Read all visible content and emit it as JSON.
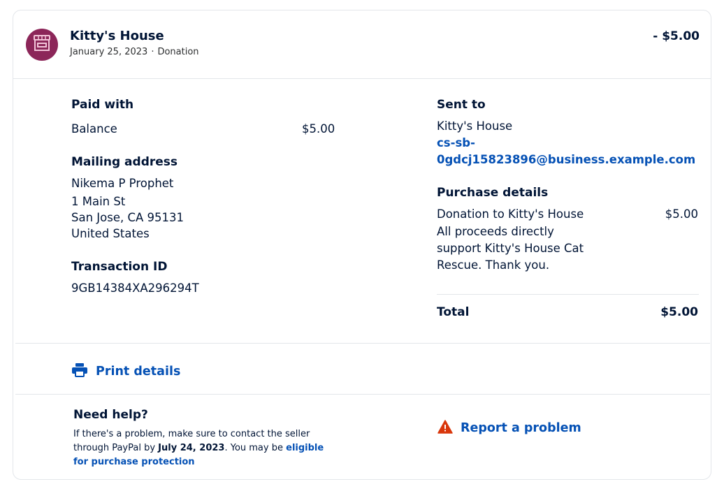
{
  "header": {
    "merchant_name": "Kitty's House",
    "date": "January 25, 2023",
    "separator": "·",
    "type": "Donation",
    "amount": "- $5.00",
    "avatar_icon": "store-icon",
    "avatar_color": "#8c2659"
  },
  "paid_with": {
    "label": "Paid with",
    "method": "Balance",
    "amount": "$5.00"
  },
  "mailing_address": {
    "label": "Mailing address",
    "name": "Nikema P Prophet",
    "street": "1 Main St",
    "city_line": "San Jose, CA 95131",
    "country": "United States"
  },
  "transaction": {
    "label": "Transaction ID",
    "id": "9GB14384XA296294T"
  },
  "sent_to": {
    "label": "Sent to",
    "name": "Kitty's House",
    "email_line1": "cs-sb-",
    "email_line2": "0gdcj15823896@business.example.com"
  },
  "purchase_details": {
    "label": "Purchase details",
    "item_line1": "Donation to Kitty's House",
    "item_amount": "$5.00",
    "desc_line1": "All proceeds directly",
    "desc_line2": "support Kitty's House Cat",
    "desc_line3": "Rescue. Thank you.",
    "total_label": "Total",
    "total_amount": "$5.00"
  },
  "actions": {
    "print_label": "Print details",
    "print_icon": "printer-icon",
    "report_label": "Report a problem",
    "report_icon": "warning-icon"
  },
  "help": {
    "title": "Need help?",
    "text_part1": "If there's a problem, make sure to contact the seller through PayPal by ",
    "deadline": "July 24, 2023",
    "text_part2": ". You may be ",
    "link_text": "eligible for purchase protection"
  },
  "colors": {
    "link": "#0551b5",
    "text": "#001435",
    "warning": "#d9360b",
    "border": "#e3e6ea"
  }
}
